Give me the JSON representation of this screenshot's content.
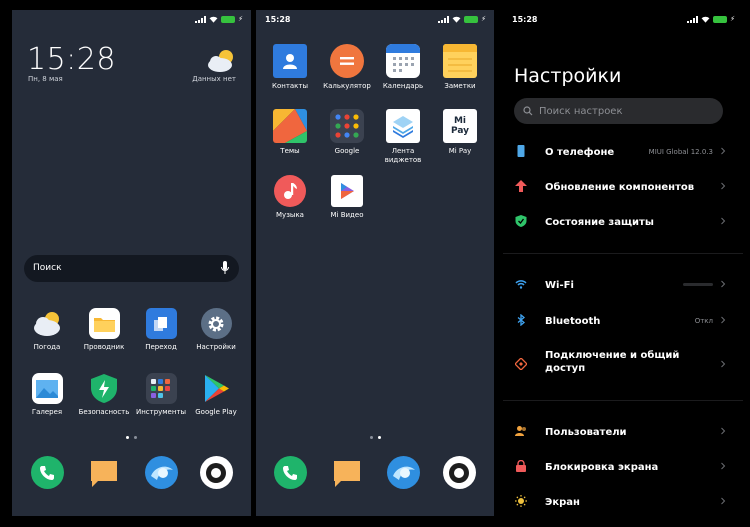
{
  "home": {
    "status_time": "",
    "clock": "15:28",
    "date": "Пн, 8 мая",
    "weather_text": "Данных нет",
    "search_placeholder": "Поиск",
    "apps": [
      {
        "label": "Погода",
        "icon": "weather-icon"
      },
      {
        "label": "Проводник",
        "icon": "folder-icon"
      },
      {
        "label": "Переход",
        "icon": "transfer-icon"
      },
      {
        "label": "Настройки",
        "icon": "gear-icon"
      },
      {
        "label": "Галерея",
        "icon": "gallery-icon"
      },
      {
        "label": "Безопасность",
        "icon": "shield-icon"
      },
      {
        "label": "Инструменты",
        "icon": "tools-folder-icon"
      },
      {
        "label": "Google Play",
        "icon": "play-store-icon"
      }
    ],
    "dock": [
      "phone-icon",
      "messages-icon",
      "browser-icon",
      "camera-icon"
    ]
  },
  "drawer": {
    "status_time": "15:28",
    "apps": [
      {
        "label": "Контакты",
        "icon": "contacts-icon"
      },
      {
        "label": "Калькулятор",
        "icon": "calculator-icon"
      },
      {
        "label": "Календарь",
        "icon": "calendar-icon"
      },
      {
        "label": "Заметки",
        "icon": "notes-icon"
      },
      {
        "label": "Темы",
        "icon": "themes-icon"
      },
      {
        "label": "Google",
        "icon": "google-folder-icon"
      },
      {
        "label": "Лента\nвиджетов",
        "icon": "widgets-icon"
      },
      {
        "label": "Mi Pay",
        "icon": "mi-pay-icon"
      },
      {
        "label": "Музыка",
        "icon": "music-icon"
      },
      {
        "label": "Mi Видео",
        "icon": "video-icon"
      }
    ],
    "mipay_logo_text": "Mi\nPay",
    "dock": [
      "phone-icon",
      "messages-icon",
      "browser-icon",
      "camera-icon"
    ]
  },
  "settings": {
    "status_time": "15:28",
    "title": "Настройки",
    "search_placeholder": "Поиск настроек",
    "rows": [
      {
        "label": "О телефоне",
        "value": "MIUI Global 12.0.3",
        "icon": "phone-info-icon",
        "color": "#4fa8e8"
      },
      {
        "label": "Обновление компонентов",
        "value": "",
        "icon": "update-arrow-icon",
        "color": "#f05a5a"
      },
      {
        "label": "Состояние защиты",
        "value": "",
        "icon": "shield-check-icon",
        "color": "#2fc46a"
      },
      {
        "label": "Wi-Fi",
        "value": "",
        "icon": "wifi-icon",
        "color": "#3ea2f0"
      },
      {
        "label": "Bluetooth",
        "value": "Откл",
        "icon": "bluetooth-icon",
        "color": "#3ea2f0"
      },
      {
        "label": "Подключение и общий доступ",
        "value": "",
        "icon": "connection-icon",
        "color": "#f0663e"
      },
      {
        "label": "Пользователи",
        "value": "",
        "icon": "users-icon",
        "color": "#f0a23e"
      },
      {
        "label": "Блокировка экрана",
        "value": "",
        "icon": "lock-icon",
        "color": "#f05a5a"
      },
      {
        "label": "Экран",
        "value": "",
        "icon": "sun-icon",
        "color": "#f0c23e"
      }
    ]
  },
  "colors": {
    "home_bg": "#252c39",
    "settings_bg": "#000000",
    "battery_green": "#36c23e"
  }
}
